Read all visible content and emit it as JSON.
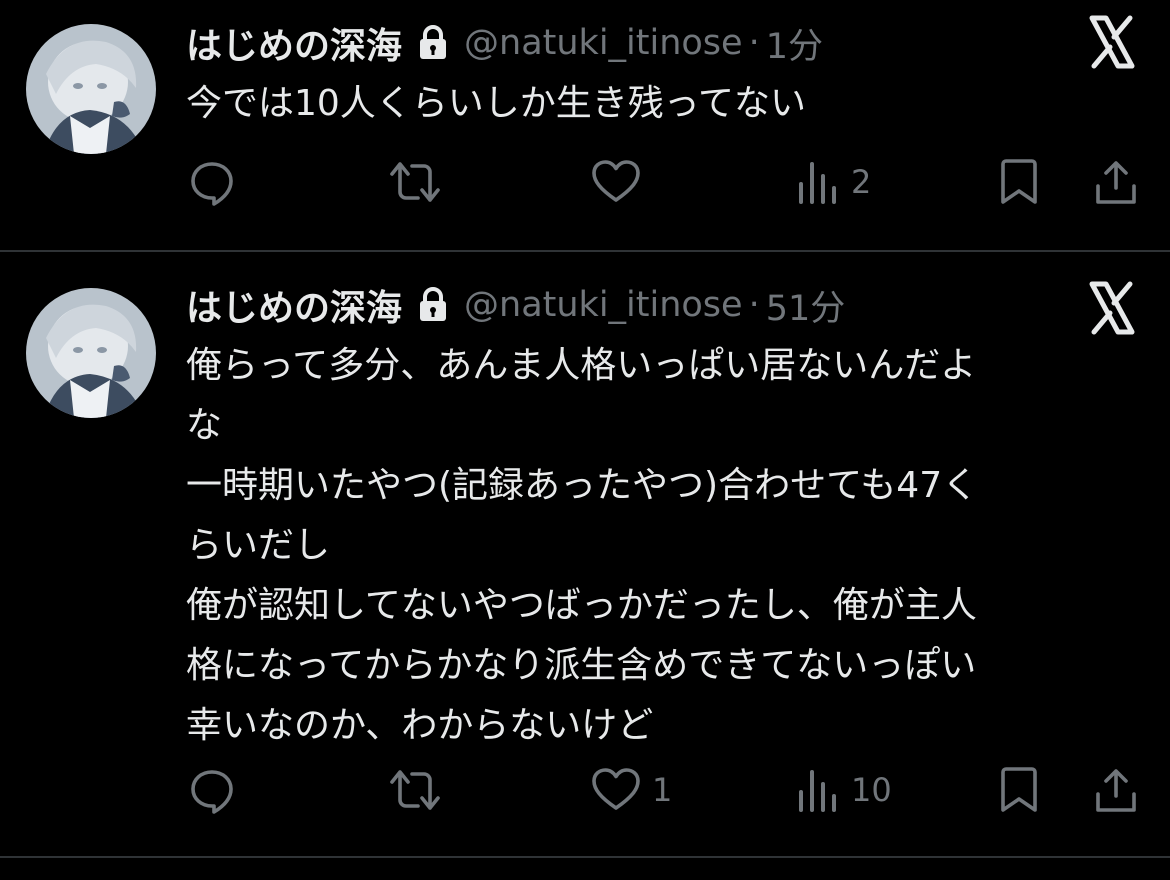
{
  "tweets": [
    {
      "author_name": "はじめの深海",
      "handle": "@natuki_itinose",
      "separator": "·",
      "time": "1分",
      "lines": [
        "今では10人くらいしか生き残ってない"
      ],
      "reply_count": "",
      "retweet_count": "",
      "like_count": "",
      "view_count": "2"
    },
    {
      "author_name": "はじめの深海",
      "handle": "@natuki_itinose",
      "separator": "·",
      "time": "51分",
      "lines": [
        "俺らって多分、あんま人格いっぱい居ないんだよ",
        "な",
        "一時期いたやつ(記録あったやつ)合わせても47く",
        "らいだし",
        "俺が認知してないやつばっかだったし、俺が主人",
        "格になってからかなり派生含めできてないっぽい",
        "幸いなのか、わからないけど"
      ],
      "reply_count": "",
      "retweet_count": "",
      "like_count": "1",
      "view_count": "10"
    }
  ],
  "icons": {
    "lock": "lock-icon",
    "brand": "x-logo-icon",
    "reply": "reply-icon",
    "retweet": "retweet-icon",
    "like": "heart-icon",
    "views": "views-icon",
    "bookmark": "bookmark-icon",
    "share": "share-icon"
  },
  "colors": {
    "background": "#000000",
    "text": "#e7e9ea",
    "secondary": "#71767b",
    "divider": "#2f3336"
  }
}
